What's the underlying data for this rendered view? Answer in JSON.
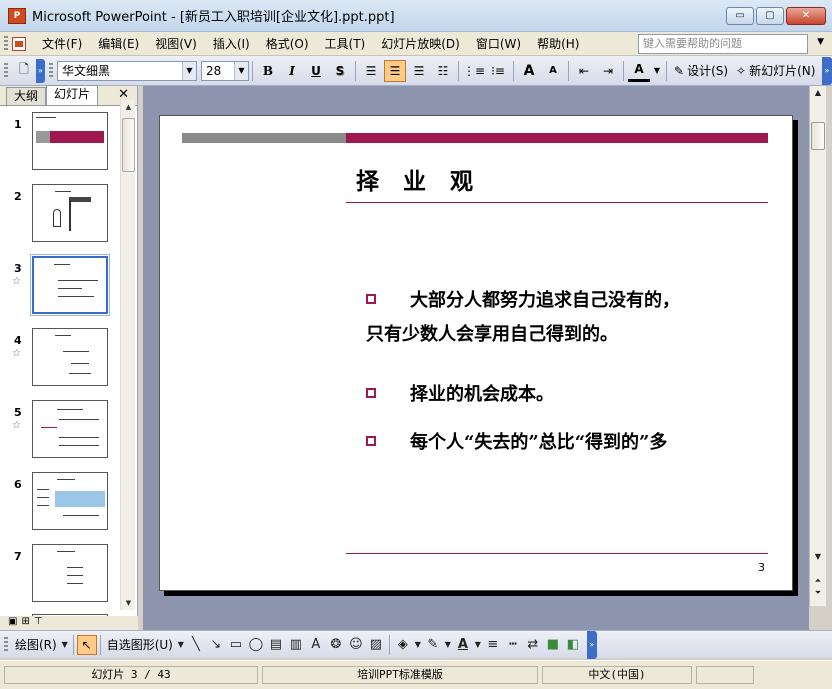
{
  "window": {
    "app_icon_label": "P",
    "title": "Microsoft PowerPoint - [新员工入职培训[企业文化].ppt.ppt]",
    "buttons": [
      "▭",
      "▢",
      "✕"
    ]
  },
  "menu": {
    "items": [
      "文件(F)",
      "编辑(E)",
      "视图(V)",
      "插入(I)",
      "格式(O)",
      "工具(T)",
      "幻灯片放映(D)",
      "窗口(W)",
      "帮助(H)"
    ],
    "help_placeholder": "键入需要帮助的问题"
  },
  "toolbar": {
    "font_name": "华文细黑",
    "font_size": "28",
    "bold": "B",
    "italic": "I",
    "underline": "U",
    "shadow": "S",
    "increase_font": "A",
    "decrease_font": "A",
    "font_color": "A",
    "design_label": "设计(S)",
    "new_slide_label": "新幻灯片(N)"
  },
  "left_pane": {
    "tabs": [
      "大纲",
      "幻灯片"
    ],
    "close": "✕",
    "thumbnails": [
      {
        "num": "1",
        "star": false,
        "selected": false
      },
      {
        "num": "2",
        "star": false,
        "selected": false
      },
      {
        "num": "3",
        "star": true,
        "selected": true
      },
      {
        "num": "4",
        "star": true,
        "selected": false
      },
      {
        "num": "5",
        "star": true,
        "selected": false
      },
      {
        "num": "6",
        "star": false,
        "selected": false
      },
      {
        "num": "7",
        "star": false,
        "selected": false
      }
    ]
  },
  "slide": {
    "title": "择 业 观",
    "bullets": [
      {
        "line1": "大部分人都努力追求自己没有的，",
        "line2": "只有少数人会享用自己得到的。"
      },
      {
        "line1": "择业的机会成本。"
      },
      {
        "line1": "每个人“失去的”总比“得到的”多"
      }
    ],
    "page_number": "3"
  },
  "draw_toolbar": {
    "draw_label": "绘图(R)",
    "autoshapes_label": "自选图形(U)"
  },
  "status": {
    "slide_info": "幻灯片 3 / 43",
    "template": "培训PPT标准模版",
    "language": "中文(中国)"
  },
  "colors": {
    "accent": "#a01850",
    "gray_bar": "#8a8a8a"
  }
}
